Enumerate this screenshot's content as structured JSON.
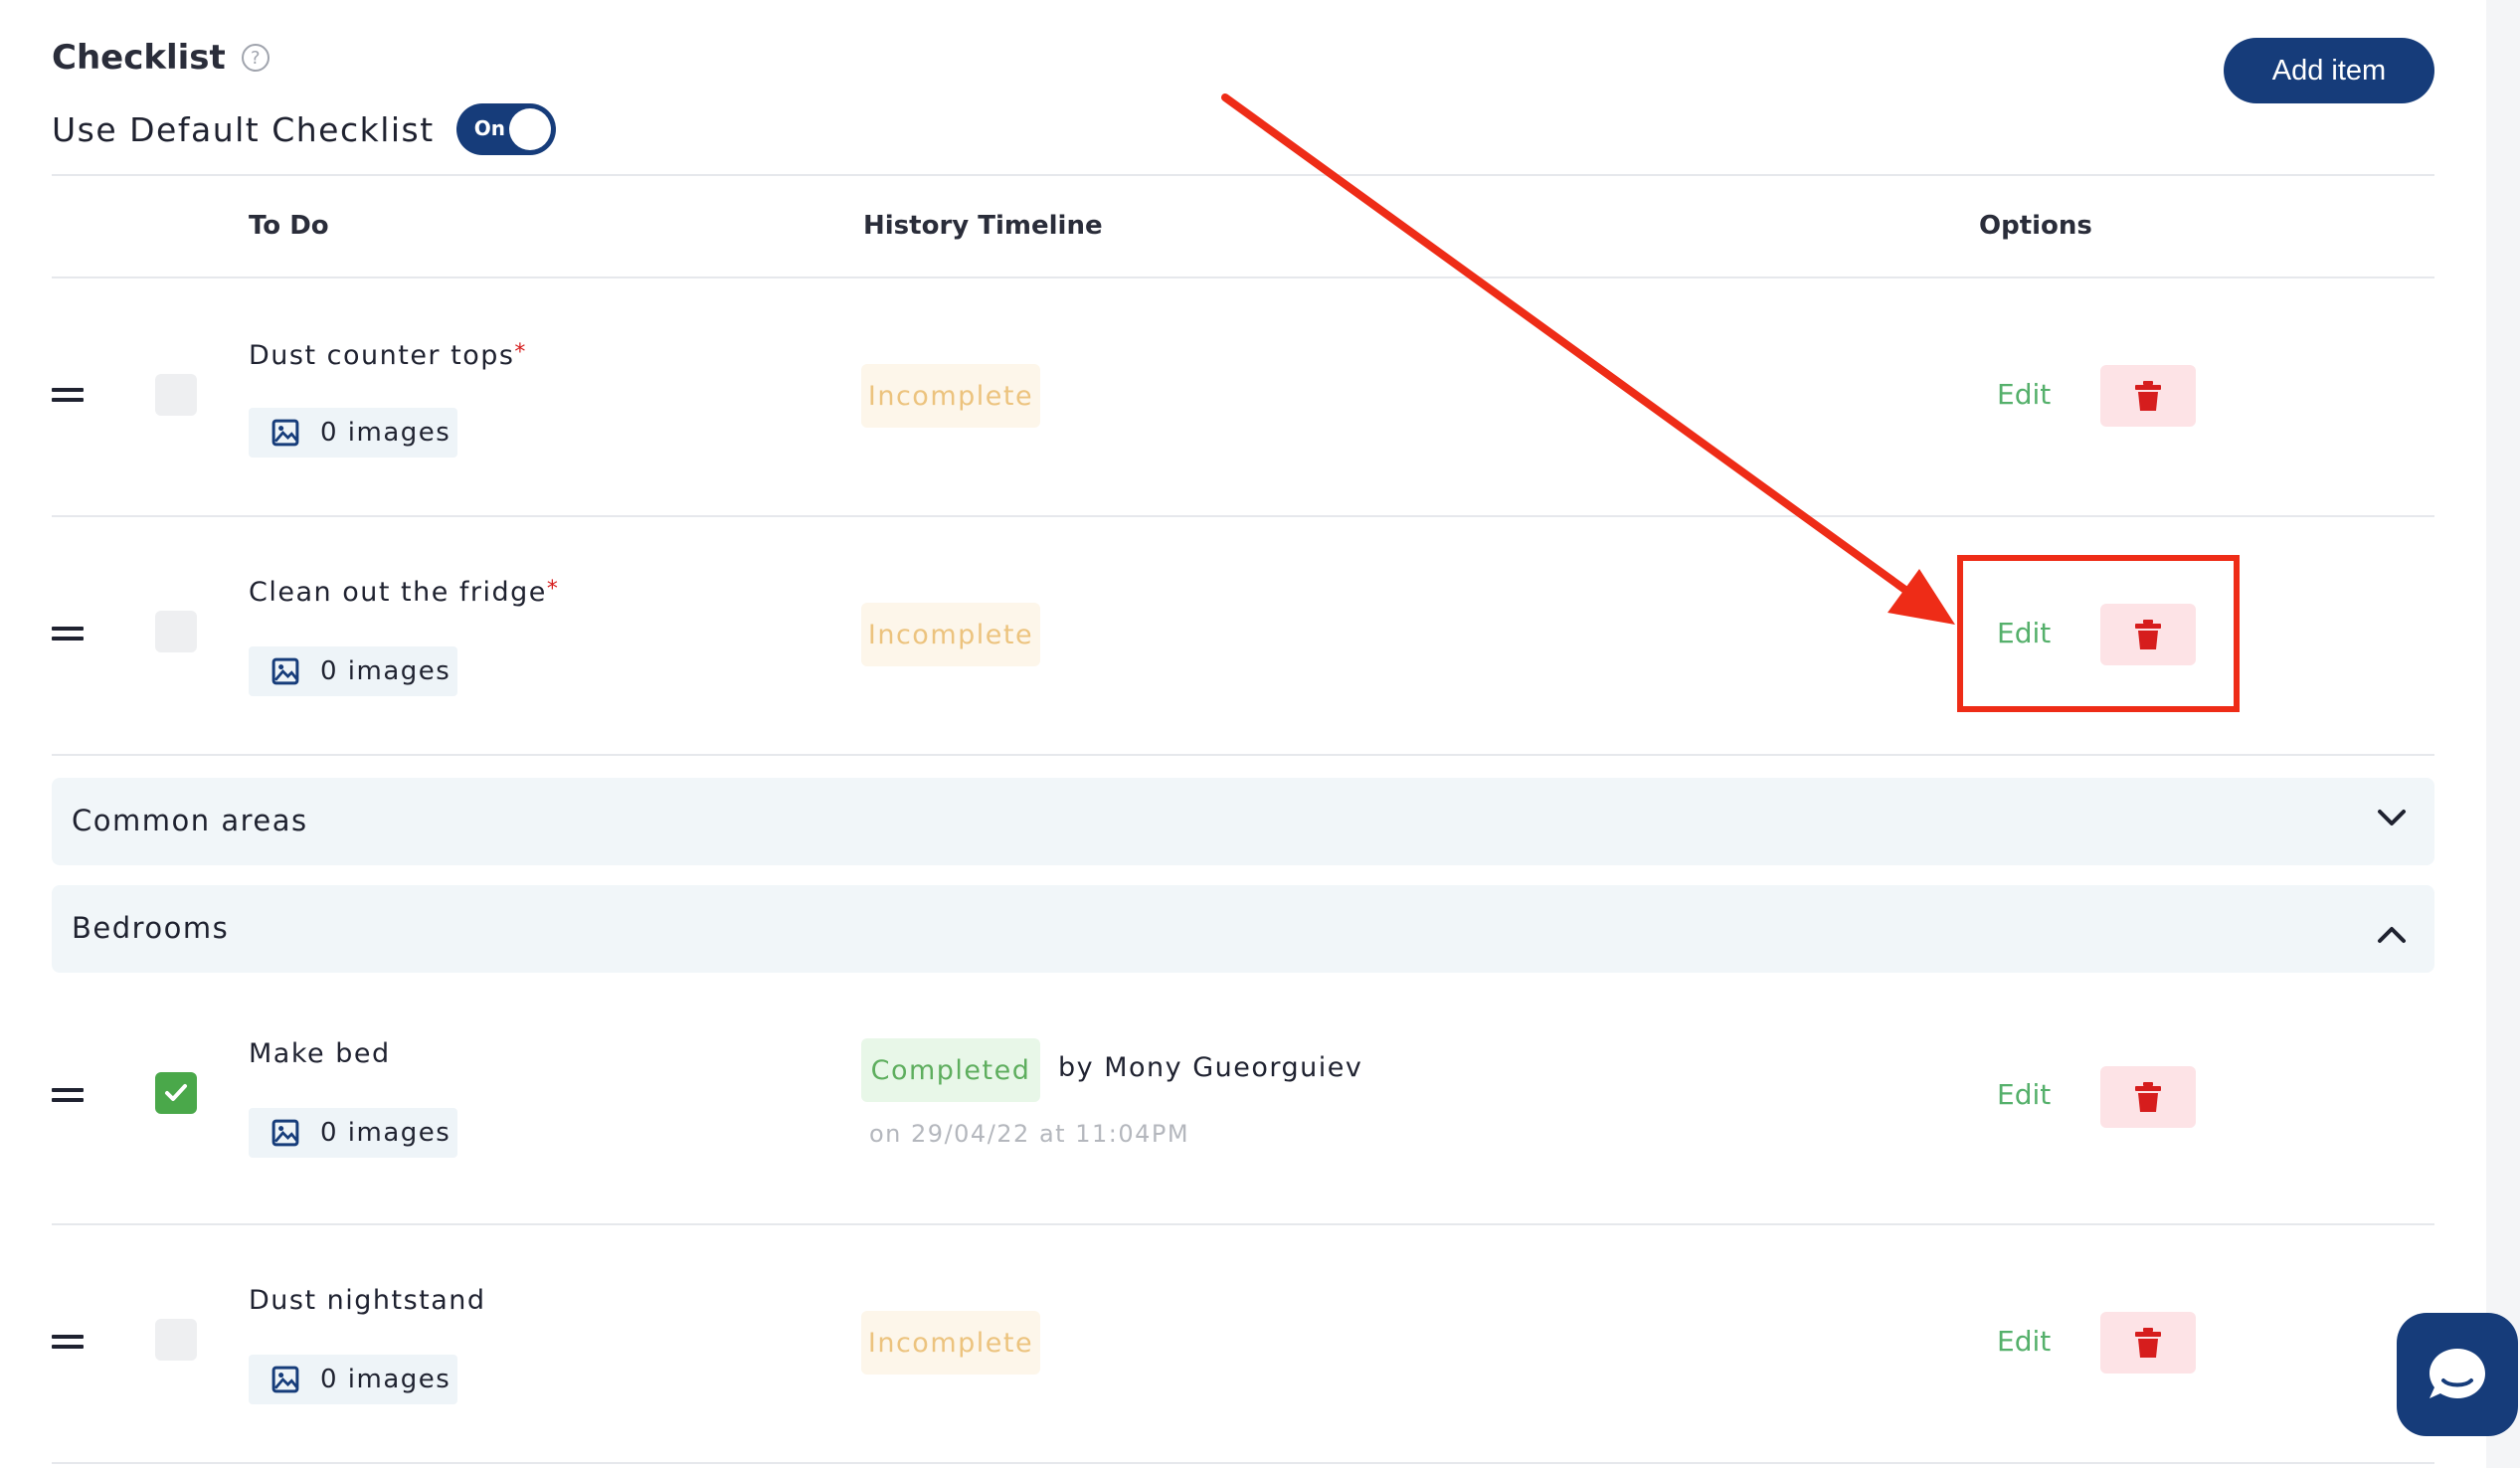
{
  "header": {
    "title": "Checklist",
    "use_default_label": "Use Default Checklist",
    "toggle_state": "On",
    "add_button_label": "Add item"
  },
  "columns": {
    "todo": "To Do",
    "history": "History Timeline",
    "options": "Options"
  },
  "items": [
    {
      "name": "Dust counter tops",
      "required": true,
      "checked": false,
      "images": "0 images",
      "status": "Incomplete",
      "edit_label": "Edit"
    },
    {
      "name": "Clean out the fridge",
      "required": true,
      "checked": false,
      "images": "0 images",
      "status": "Incomplete",
      "edit_label": "Edit"
    }
  ],
  "sections": [
    {
      "name": "Common areas",
      "expanded": false
    },
    {
      "name": "Bedrooms",
      "expanded": true
    }
  ],
  "bedroom_items": [
    {
      "name": "Make bed",
      "required": false,
      "checked": true,
      "images": "0 images",
      "status": "Completed",
      "by": "by Mony Gueorguiev",
      "on": "on 29/04/22 at 11:04PM",
      "edit_label": "Edit"
    },
    {
      "name": "Dust nightstand",
      "required": false,
      "checked": false,
      "images": "0 images",
      "status": "Incomplete",
      "edit_label": "Edit"
    }
  ],
  "required_marker": "*",
  "colors": {
    "primary": "#163c7a",
    "edit": "#55b06b",
    "delete_bg": "#fde3e6",
    "delete_icon": "#d61d1d",
    "incomplete": "#ecc37e",
    "completed": "#5eae5e",
    "annotation": "#ee2c17"
  }
}
